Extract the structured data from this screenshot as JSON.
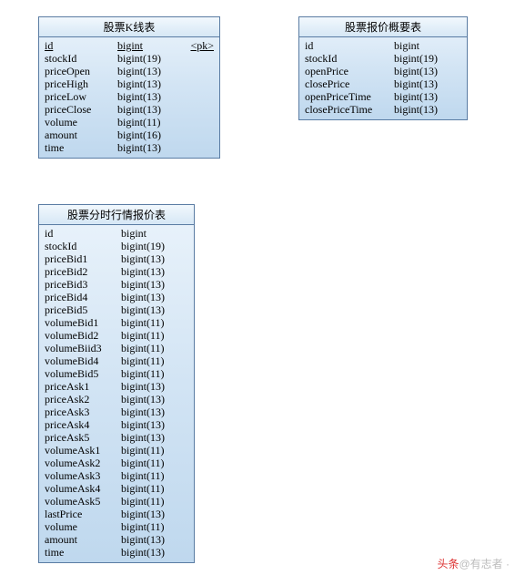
{
  "tables": {
    "kline": {
      "title": "股票K线表",
      "columns": [
        {
          "name": "id",
          "type": "bigint",
          "pk": true,
          "pk_label": "<pk>"
        },
        {
          "name": "stockId",
          "type": "bigint(19)",
          "pk": false
        },
        {
          "name": "priceOpen",
          "type": "bigint(13)",
          "pk": false
        },
        {
          "name": "priceHigh",
          "type": "bigint(13)",
          "pk": false
        },
        {
          "name": "priceLow",
          "type": "bigint(13)",
          "pk": false
        },
        {
          "name": "priceClose",
          "type": "bigint(13)",
          "pk": false
        },
        {
          "name": "volume",
          "type": "bigint(11)",
          "pk": false
        },
        {
          "name": "amount",
          "type": "bigint(16)",
          "pk": false
        },
        {
          "name": "time",
          "type": "bigint(13)",
          "pk": false
        }
      ]
    },
    "summary": {
      "title": "股票报价概要表",
      "columns": [
        {
          "name": "id",
          "type": "bigint"
        },
        {
          "name": "stockId",
          "type": "bigint(19)"
        },
        {
          "name": "openPrice",
          "type": "bigint(13)"
        },
        {
          "name": "closePrice",
          "type": "bigint(13)"
        },
        {
          "name": "openPriceTime",
          "type": "bigint(13)"
        },
        {
          "name": "closePriceTime",
          "type": "bigint(13)"
        }
      ]
    },
    "tick": {
      "title": "股票分时行情报价表",
      "columns": [
        {
          "name": "id",
          "type": "bigint"
        },
        {
          "name": "stockId",
          "type": "bigint(19)"
        },
        {
          "name": "priceBid1",
          "type": "bigint(13)"
        },
        {
          "name": "priceBid2",
          "type": "bigint(13)"
        },
        {
          "name": "priceBid3",
          "type": "bigint(13)"
        },
        {
          "name": "priceBid4",
          "type": "bigint(13)"
        },
        {
          "name": "priceBid5",
          "type": "bigint(13)"
        },
        {
          "name": "volumeBid1",
          "type": "bigint(11)"
        },
        {
          "name": "volumeBid2",
          "type": "bigint(11)"
        },
        {
          "name": "volumeBiid3",
          "type": "bigint(11)"
        },
        {
          "name": "volumeBid4",
          "type": "bigint(11)"
        },
        {
          "name": "volumeBid5",
          "type": "bigint(11)"
        },
        {
          "name": "priceAsk1",
          "type": "bigint(13)"
        },
        {
          "name": "priceAsk2",
          "type": "bigint(13)"
        },
        {
          "name": "priceAsk3",
          "type": "bigint(13)"
        },
        {
          "name": "priceAsk4",
          "type": "bigint(13)"
        },
        {
          "name": "priceAsk5",
          "type": "bigint(13)"
        },
        {
          "name": "volumeAsk1",
          "type": "bigint(11)"
        },
        {
          "name": "volumeAsk2",
          "type": "bigint(11)"
        },
        {
          "name": "volumeAsk3",
          "type": "bigint(11)"
        },
        {
          "name": "volumeAsk4",
          "type": "bigint(11)"
        },
        {
          "name": "volumeAsk5",
          "type": "bigint(11)"
        },
        {
          "name": "lastPrice",
          "type": "bigint(13)"
        },
        {
          "name": "volume",
          "type": "bigint(11)"
        },
        {
          "name": "amount",
          "type": "bigint(13)"
        },
        {
          "name": "time",
          "type": "bigint(13)"
        }
      ]
    }
  },
  "watermark": {
    "prefix": "头条",
    "at": "@",
    "author": "有志者",
    "suffix": " ·"
  }
}
